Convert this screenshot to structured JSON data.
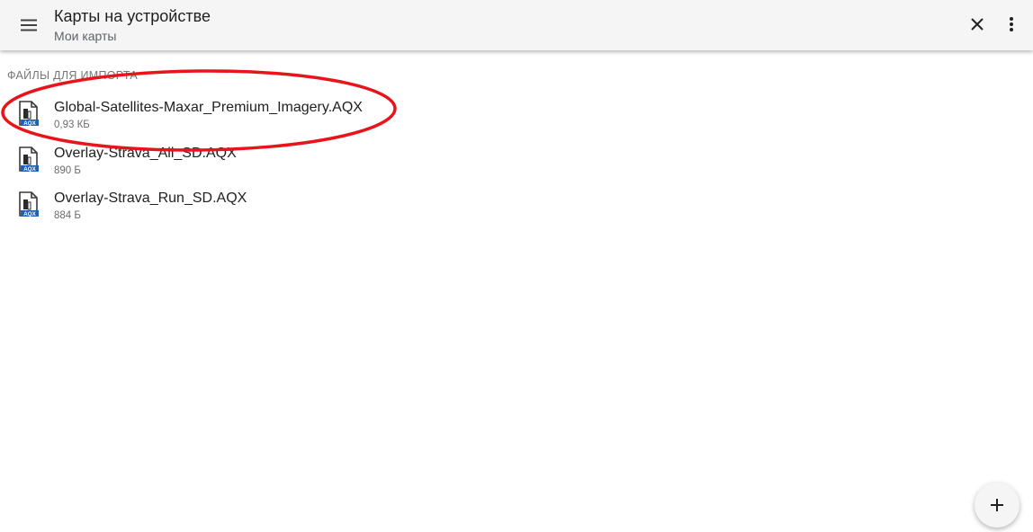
{
  "toolbar": {
    "title": "Карты на устройстве",
    "subtitle": "Мои карты",
    "menu_icon": "menu-icon",
    "close_icon": "close-icon",
    "more_icon": "more-vert-icon"
  },
  "section": {
    "header": "Файлы для импорта"
  },
  "files": [
    {
      "name": "Global-Satellites-Maxar_Premium_Imagery.AQX",
      "size": "0,93 КБ",
      "icon": "aqx-file-icon",
      "icon_badge": "AQX"
    },
    {
      "name": "Overlay-Strava_All_SD.AQX",
      "size": "890 Б",
      "icon": "aqx-file-icon",
      "icon_badge": "AQX"
    },
    {
      "name": "Overlay-Strava_Run_SD.AQX",
      "size": "884 Б",
      "icon": "aqx-file-icon",
      "icon_badge": "AQX"
    }
  ],
  "fab": {
    "icon": "plus-icon"
  },
  "colors": {
    "toolbar_bg": "#f5f5f5",
    "highlight": "#e8141c",
    "badge": "#1d62b8"
  }
}
